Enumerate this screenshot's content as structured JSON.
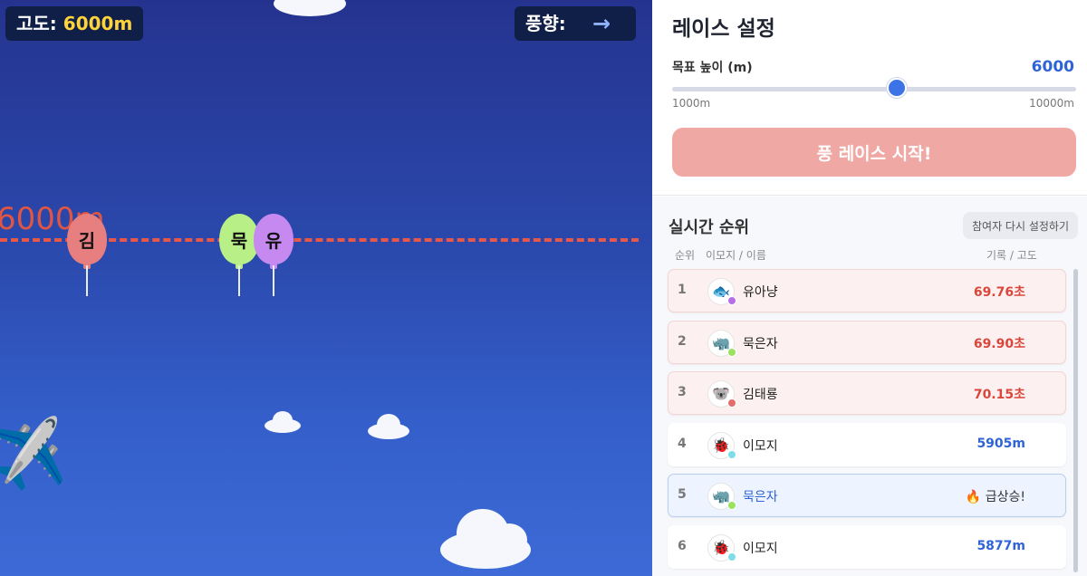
{
  "hud": {
    "altitude_label": "고도:",
    "altitude_value": "6000m",
    "wind_label": "풍향:",
    "wind_arrow": "→"
  },
  "game": {
    "goal_label": "6000m",
    "balloons": [
      {
        "initial": "김",
        "color": "#e77f80"
      },
      {
        "initial": "묵",
        "color": "#b8ef86"
      },
      {
        "initial": "유",
        "color": "#c589f0"
      }
    ]
  },
  "settings": {
    "title": "레이스 설정",
    "goal_label": "목표 높이 (m)",
    "goal_value": "6000",
    "slider": {
      "value": 6000,
      "min": 1000,
      "max": 10000
    },
    "min_label": "1000m",
    "max_label": "10000m",
    "start_button": "풍 레이스 시작!"
  },
  "ranking": {
    "title": "실시간 순위",
    "reset_button": "참여자 다시 설정하기",
    "col_rank": "순위",
    "col_name": "이모지 / 이름",
    "col_record": "기록 / 고도",
    "rows": [
      {
        "rank": "1",
        "emoji": "🐟",
        "name": "유아냥",
        "record": "69.76초",
        "kind": "time",
        "dot": "#b46ee6"
      },
      {
        "rank": "2",
        "emoji": "🦏",
        "name": "묵은자",
        "record": "69.90초",
        "kind": "time",
        "dot": "#9be35f"
      },
      {
        "rank": "3",
        "emoji": "🐨",
        "name": "김태룡",
        "record": "70.15초",
        "kind": "time",
        "dot": "#e46c6c"
      },
      {
        "rank": "4",
        "emoji": "🐞",
        "name": "이모지",
        "record": "5905m",
        "kind": "alt",
        "dot": "#7fdde9"
      },
      {
        "rank": "5",
        "emoji": "🦏",
        "name": "묵은자",
        "record": "🔥 급상승!",
        "kind": "surge",
        "dot": "#9be35f"
      },
      {
        "rank": "6",
        "emoji": "🐞",
        "name": "이모지",
        "record": "5877m",
        "kind": "alt",
        "dot": "#7fdde9"
      }
    ]
  }
}
